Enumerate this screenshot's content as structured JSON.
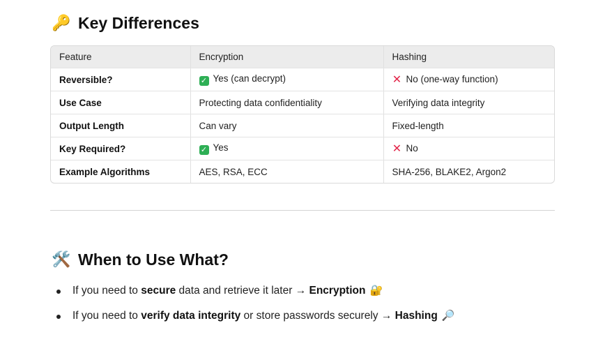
{
  "section1": {
    "emoji": "🔑",
    "title": "Key Differences"
  },
  "table": {
    "headers": [
      "Feature",
      "Encryption",
      "Hashing"
    ],
    "rows": [
      {
        "feature": "Reversible?",
        "encryption": "Yes (can decrypt)",
        "encryption_icon": "check",
        "hashing": "No (one-way function)",
        "hashing_icon": "cross"
      },
      {
        "feature": "Use Case",
        "encryption": "Protecting data confidentiality",
        "encryption_icon": "",
        "hashing": "Verifying data integrity",
        "hashing_icon": ""
      },
      {
        "feature": "Output Length",
        "encryption": "Can vary",
        "encryption_icon": "",
        "hashing": "Fixed-length",
        "hashing_icon": ""
      },
      {
        "feature": "Key Required?",
        "encryption": "Yes",
        "encryption_icon": "check",
        "hashing": "No",
        "hashing_icon": "cross"
      },
      {
        "feature": "Example Algorithms",
        "encryption": "AES, RSA, ECC",
        "encryption_icon": "",
        "hashing": "SHA-256, BLAKE2, Argon2",
        "hashing_icon": ""
      }
    ]
  },
  "section2": {
    "emoji": "🛠️",
    "title": "When to Use What?"
  },
  "bullets": [
    {
      "p1": "If you need to ",
      "b1": "secure",
      "p2": " data and retrieve it later → ",
      "b2": "Encryption",
      "emoji": "🔐"
    },
    {
      "p1": "If you need to ",
      "b1": "verify data integrity",
      "p2": " or store passwords securely → ",
      "b2": "Hashing",
      "emoji": "🔎"
    }
  ],
  "colors": {
    "check_bg": "#2eaf55",
    "cross": "#e3264a",
    "header_bg": "#ececec"
  }
}
